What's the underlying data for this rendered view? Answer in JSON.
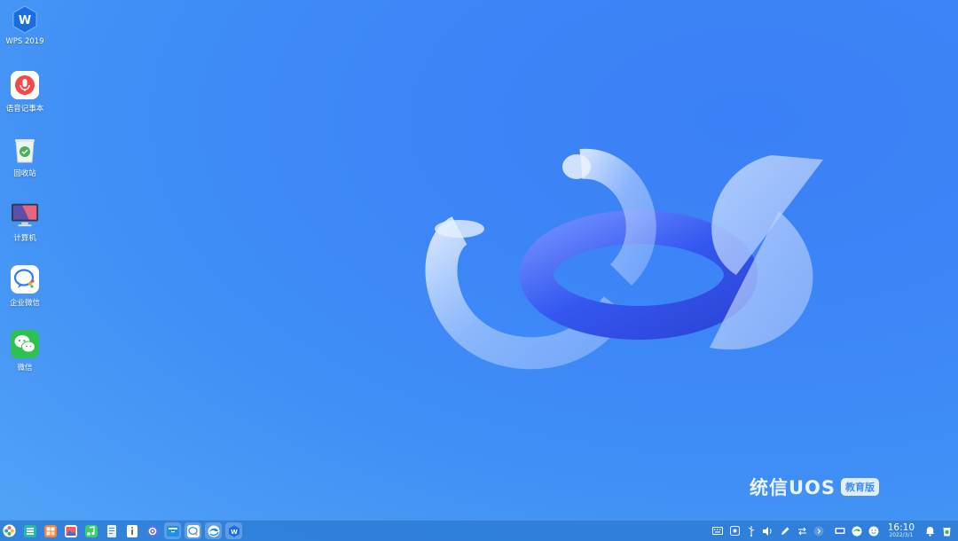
{
  "desktop": {
    "icons": [
      {
        "label": "WPS 2019",
        "icon": "wps-office-icon"
      },
      {
        "label": "语音记事本",
        "icon": "voice-notepad-icon"
      },
      {
        "label": "回收站",
        "icon": "recycle-bin-icon"
      },
      {
        "label": "计算机",
        "icon": "computer-icon"
      },
      {
        "label": "企业微信",
        "icon": "wecom-icon"
      },
      {
        "label": "微信",
        "icon": "wechat-icon"
      }
    ]
  },
  "brand": {
    "name": "统信UOS",
    "badge": "教育版"
  },
  "taskbar": {
    "dock": [
      {
        "icon": "launcher-icon"
      },
      {
        "icon": "multitasking-view-icon"
      },
      {
        "icon": "app-store-icon"
      },
      {
        "icon": "image-viewer-icon"
      },
      {
        "icon": "music-icon"
      },
      {
        "icon": "document-viewer-icon"
      },
      {
        "icon": "text-editor-icon"
      },
      {
        "icon": "settings-icon"
      },
      {
        "icon": "file-manager-icon"
      },
      {
        "icon": "wecom-icon"
      },
      {
        "icon": "browser-icon"
      },
      {
        "icon": "wps-office-icon"
      }
    ],
    "tray": [
      {
        "icon": "keyboard-icon"
      },
      {
        "icon": "screenshot-icon"
      },
      {
        "icon": "usb-icon"
      },
      {
        "icon": "volume-icon"
      },
      {
        "icon": "pen-icon"
      },
      {
        "icon": "network-icon"
      },
      {
        "icon": "expand-tray-icon"
      },
      {
        "icon": "display-icon"
      },
      {
        "icon": "browser-tray-icon"
      },
      {
        "icon": "assistant-icon"
      }
    ],
    "clock": {
      "time": "16:10",
      "date": "2022/3/1"
    },
    "right": [
      {
        "icon": "notification-bell-icon"
      },
      {
        "icon": "trash-tray-icon"
      }
    ]
  }
}
